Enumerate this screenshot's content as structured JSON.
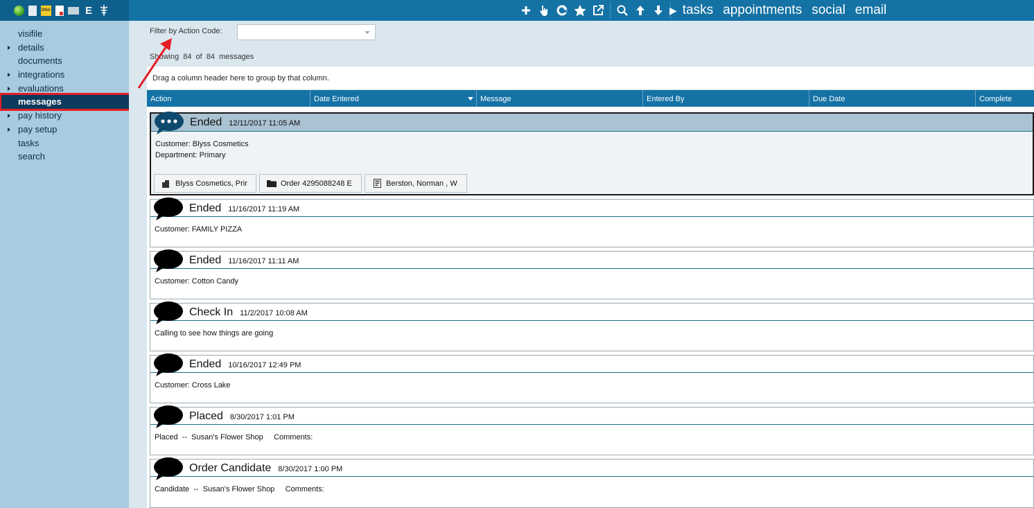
{
  "toolbar": {
    "left_icons": [
      "status-icon",
      "document-icon",
      "dna-icon",
      "pdf-icon",
      "card-icon",
      "e-icon",
      "caduceus-icon"
    ],
    "dna_label": "DNA",
    "e_label": "E",
    "actions": [
      "plus-icon",
      "hand-pointer-icon",
      "refresh-icon",
      "star-icon",
      "external-link-icon",
      "search-icon",
      "arrow-up-icon",
      "arrow-down-icon"
    ],
    "play_label": "▶",
    "nav": [
      "tasks",
      "appointments",
      "social",
      "email"
    ]
  },
  "sidebar": {
    "items": [
      {
        "label": "visifile",
        "expandable": false
      },
      {
        "label": "details",
        "expandable": true
      },
      {
        "label": "documents",
        "expandable": false
      },
      {
        "label": "integrations",
        "expandable": true
      },
      {
        "label": "evaluations",
        "expandable": true
      },
      {
        "label": "messages",
        "expandable": false,
        "active": true
      },
      {
        "label": "pay history",
        "expandable": true
      },
      {
        "label": "pay setup",
        "expandable": true
      },
      {
        "label": "tasks",
        "expandable": false
      },
      {
        "label": "search",
        "expandable": false
      }
    ]
  },
  "filter": {
    "label": "Filter by Action Code:",
    "value": ""
  },
  "showing": "Showing 84 of 84 messages",
  "grid": {
    "group_hint": "Drag a column header here to group by that column.",
    "columns": [
      "Action",
      "Date Entered",
      "Message",
      "Entered By",
      "Due Date",
      "Complete"
    ]
  },
  "messages": [
    {
      "action": "Ended",
      "date": "12/11/2017 11:05 AM",
      "lines": [
        "Customer: Blyss Cosmetics",
        "Department: Primary"
      ],
      "selected": true,
      "chips": [
        {
          "icon": "building-icon",
          "label": "Blyss Cosmetics, Prir"
        },
        {
          "icon": "folder-icon",
          "label": "Order 4295088248 E"
        },
        {
          "icon": "person-card-icon",
          "label": "Berston, Norman , W"
        }
      ]
    },
    {
      "action": "Ended",
      "date": "11/16/2017 11:19 AM",
      "lines": [
        "Customer: FAMILY PIZZA"
      ]
    },
    {
      "action": "Ended",
      "date": "11/16/2017 11:11 AM",
      "lines": [
        "Customer:  Cotton Candy"
      ]
    },
    {
      "action": "Check In",
      "date": "11/2/2017 10:08 AM",
      "lines": [
        "Calling to see how things are going"
      ]
    },
    {
      "action": "Ended",
      "date": "10/16/2017 12:49 PM",
      "lines": [
        "Customer: Cross Lake"
      ]
    },
    {
      "action": "Placed",
      "date": "8/30/2017 1:01 PM",
      "lines": [
        "Placed  --  Susan's Flower Shop     Comments:"
      ]
    },
    {
      "action": "Order Candidate",
      "date": "8/30/2017 1:00 PM",
      "lines": [
        "Candidate  --  Susan's Flower Shop     Comments:"
      ]
    }
  ],
  "colors": {
    "header_blue": "#1472a5",
    "sidebar_bg": "#a9cbe0",
    "active_item": "#0c3a5c",
    "highlight_red": "#e41e26"
  }
}
